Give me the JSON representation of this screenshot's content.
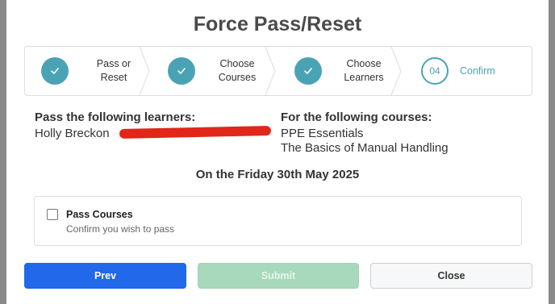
{
  "modal": {
    "title": "Force Pass/Reset"
  },
  "steps": [
    {
      "label_line1": "Pass or",
      "label_line2": "Reset",
      "state": "done",
      "icon": "check-icon"
    },
    {
      "label_line1": "Choose",
      "label_line2": "Courses",
      "state": "done",
      "icon": "check-icon"
    },
    {
      "label_line1": "Choose",
      "label_line2": "Learners",
      "state": "done",
      "icon": "check-icon"
    },
    {
      "number": "04",
      "label_line1": "Confirm",
      "state": "current"
    }
  ],
  "learners": {
    "heading": "Pass the following learners:",
    "name": "Holly Breckon"
  },
  "courses": {
    "heading": "For the following courses:",
    "items": [
      "PPE Essentials",
      "The Basics of Manual Handling"
    ]
  },
  "date_line": "On the Friday 30th May 2025",
  "confirm": {
    "checkbox_label": "Pass Courses",
    "checkbox_sub": "Confirm you wish to pass",
    "checked": false
  },
  "buttons": {
    "prev": "Prev",
    "submit": "Submit",
    "close": "Close"
  },
  "colors": {
    "accent": "#4aa3b5",
    "primary": "#2168ea",
    "submit_disabled": "#a8d9bc",
    "redaction": "#e0271a"
  }
}
